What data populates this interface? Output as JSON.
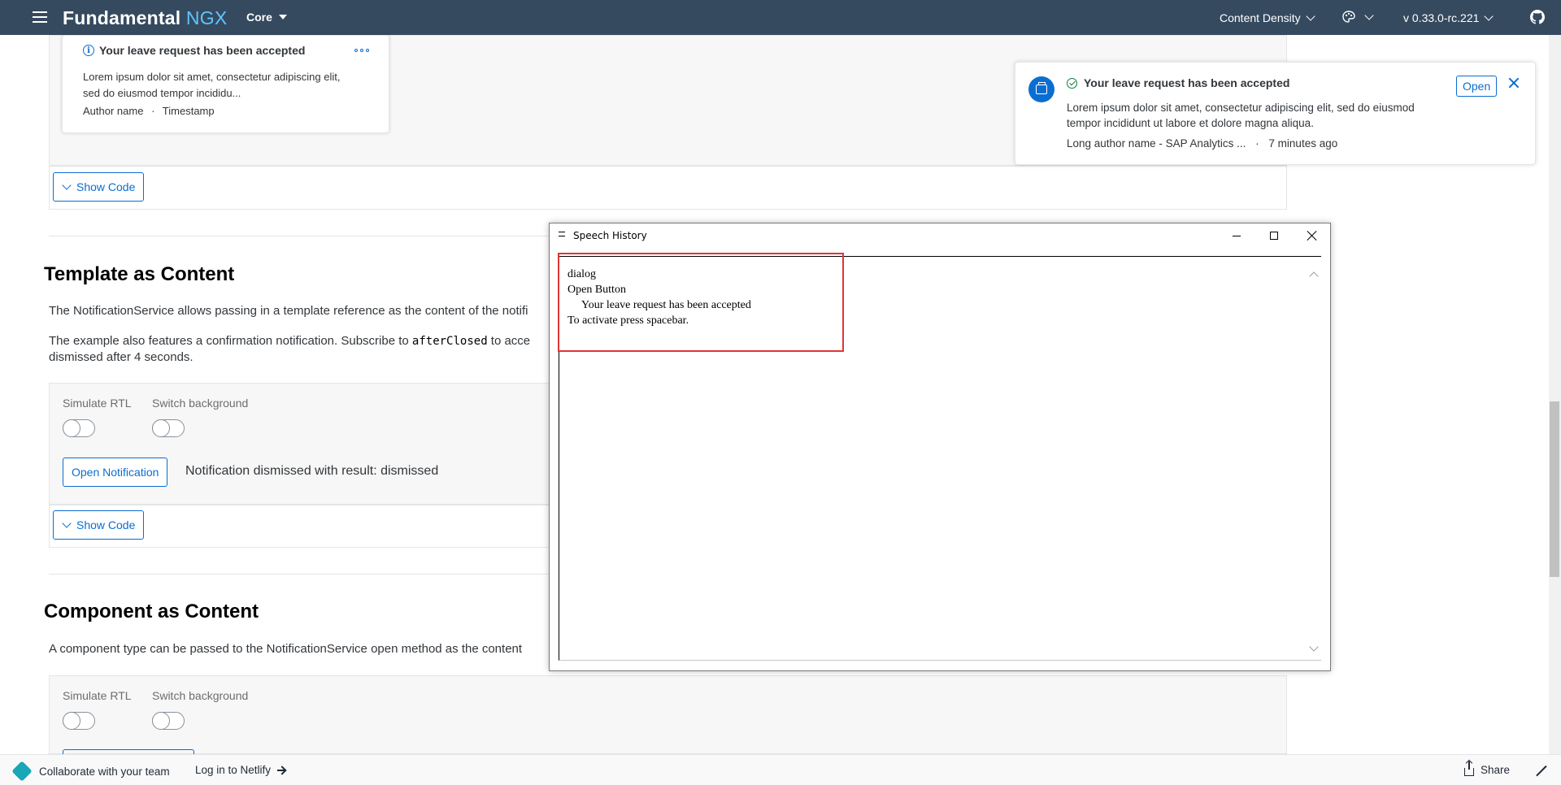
{
  "shellbar": {
    "brand_main": "Fundamental",
    "brand_accent": "NGX",
    "product_menu": "Core",
    "content_density": "Content Density",
    "version": "v 0.33.0-rc.221"
  },
  "top_card": {
    "title": "Your leave request has been accepted",
    "body": "Lorem ipsum dolor sit amet, consectetur adipiscing elit, sed do eiusmod tempor incididu...",
    "author": "Author name",
    "separator": "·",
    "timestamp": "Timestamp"
  },
  "notification": {
    "title": "Your leave request has been accepted",
    "body": "Lorem ipsum dolor sit amet, consectetur adipiscing elit, sed do eiusmod tempor incididunt ut labore et dolore magna aliqua.",
    "author": "Long author name - SAP Analytics ...",
    "separator": "·",
    "time": "7 minutes ago",
    "open_label": "Open"
  },
  "show_code_label": "Show Code",
  "template_section": {
    "title": "Template as Content",
    "para1": "The NotificationService allows passing in a template reference as the content of the notifi",
    "para2_before": "The example also features a confirmation notification. Subscribe to ",
    "para2_code": "afterClosed",
    "para2_after": " to acce",
    "para2_line2": "dismissed after 4 seconds.",
    "simulate_rtl": "Simulate RTL",
    "switch_background": "Switch background",
    "open_notification": "Open Notification",
    "result": "Notification dismissed with result: dismissed"
  },
  "component_section": {
    "title": "Component as Content",
    "para1": "A component type can be passed to the NotificationService open method as the content",
    "simulate_rtl": "Simulate RTL",
    "switch_background": "Switch background"
  },
  "speech_history": {
    "title": "Speech History",
    "lines": [
      "dialog",
      "Open Button",
      "     Your leave request has been accepted",
      "To activate press spacebar."
    ],
    "highlight_color": "#e03535"
  },
  "bottom_bar": {
    "collaborate": "Collaborate with your team",
    "login": "Log in to Netlify",
    "share": "Share"
  },
  "colors": {
    "shellbar_bg": "#354a5f",
    "brand_accent": "#5fc5ff",
    "link_blue": "#0a6ed1",
    "success_green": "#107e3e"
  }
}
